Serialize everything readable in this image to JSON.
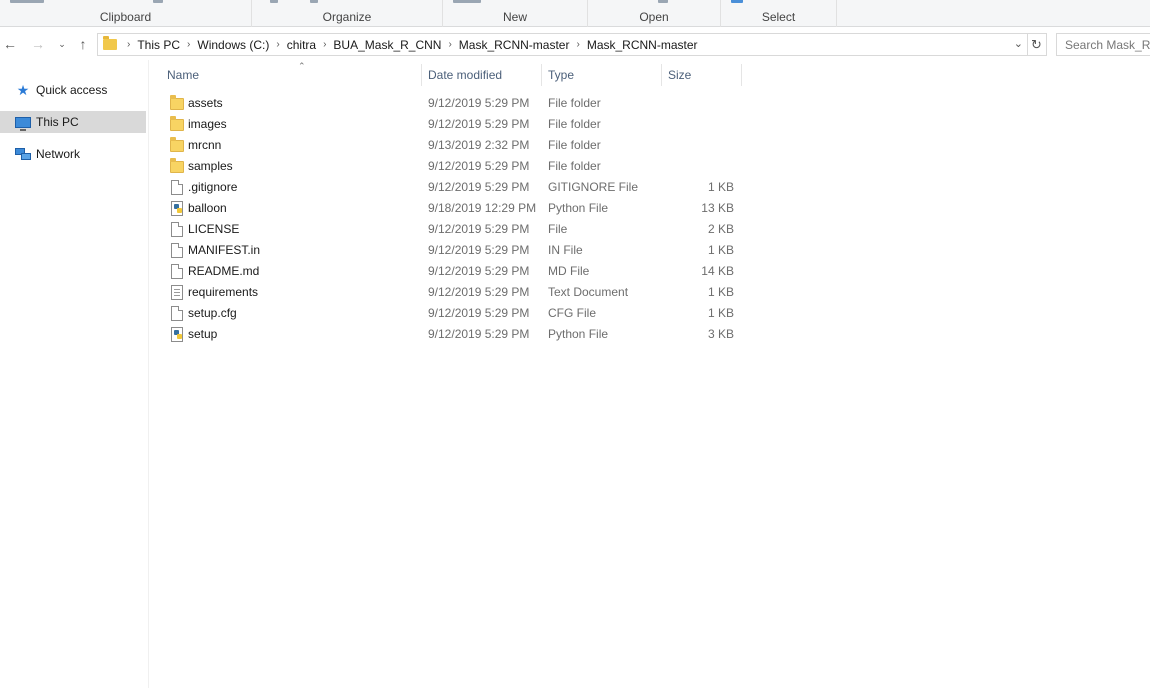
{
  "ribbon": {
    "groups": [
      "Clipboard",
      "Organize",
      "New",
      "Open",
      "Select"
    ]
  },
  "nav": {
    "back_icon": "arrow-left-icon",
    "forward_icon": "arrow-right-icon",
    "recent_icon": "chevron-down-icon",
    "up_icon": "arrow-up-icon",
    "breadcrumbs": [
      "This PC",
      "Windows (C:)",
      "chitra",
      "BUA_Mask_R_CNN",
      "Mask_RCNN-master",
      "Mask_RCNN-master"
    ],
    "search_placeholder": "Search Mask_RC"
  },
  "sidebar": {
    "items": [
      {
        "label": "Quick access",
        "icon": "star-icon",
        "selected": false
      },
      {
        "label": "This PC",
        "icon": "computer-icon",
        "selected": true
      },
      {
        "label": "Network",
        "icon": "network-icon",
        "selected": false
      }
    ]
  },
  "table": {
    "headers": {
      "name": "Name",
      "date": "Date modified",
      "type": "Type",
      "size": "Size"
    },
    "rows": [
      {
        "name": "assets",
        "date": "9/12/2019 5:29 PM",
        "type": "File folder",
        "size": "",
        "icon": "folder-icon"
      },
      {
        "name": "images",
        "date": "9/12/2019 5:29 PM",
        "type": "File folder",
        "size": "",
        "icon": "folder-icon"
      },
      {
        "name": "mrcnn",
        "date": "9/13/2019 2:32 PM",
        "type": "File folder",
        "size": "",
        "icon": "folder-icon"
      },
      {
        "name": "samples",
        "date": "9/12/2019 5:29 PM",
        "type": "File folder",
        "size": "",
        "icon": "folder-icon"
      },
      {
        "name": ".gitignore",
        "date": "9/12/2019 5:29 PM",
        "type": "GITIGNORE File",
        "size": "1 KB",
        "icon": "file-icon"
      },
      {
        "name": "balloon",
        "date": "9/18/2019 12:29 PM",
        "type": "Python File",
        "size": "13 KB",
        "icon": "python-file-icon"
      },
      {
        "name": "LICENSE",
        "date": "9/12/2019 5:29 PM",
        "type": "File",
        "size": "2 KB",
        "icon": "file-icon"
      },
      {
        "name": "MANIFEST.in",
        "date": "9/12/2019 5:29 PM",
        "type": "IN File",
        "size": "1 KB",
        "icon": "file-icon"
      },
      {
        "name": "README.md",
        "date": "9/12/2019 5:29 PM",
        "type": "MD File",
        "size": "14 KB",
        "icon": "file-icon"
      },
      {
        "name": "requirements",
        "date": "9/12/2019 5:29 PM",
        "type": "Text Document",
        "size": "1 KB",
        "icon": "text-file-icon"
      },
      {
        "name": "setup.cfg",
        "date": "9/12/2019 5:29 PM",
        "type": "CFG File",
        "size": "1 KB",
        "icon": "file-icon"
      },
      {
        "name": "setup",
        "date": "9/12/2019 5:29 PM",
        "type": "Python File",
        "size": "3 KB",
        "icon": "python-file-icon"
      }
    ]
  }
}
